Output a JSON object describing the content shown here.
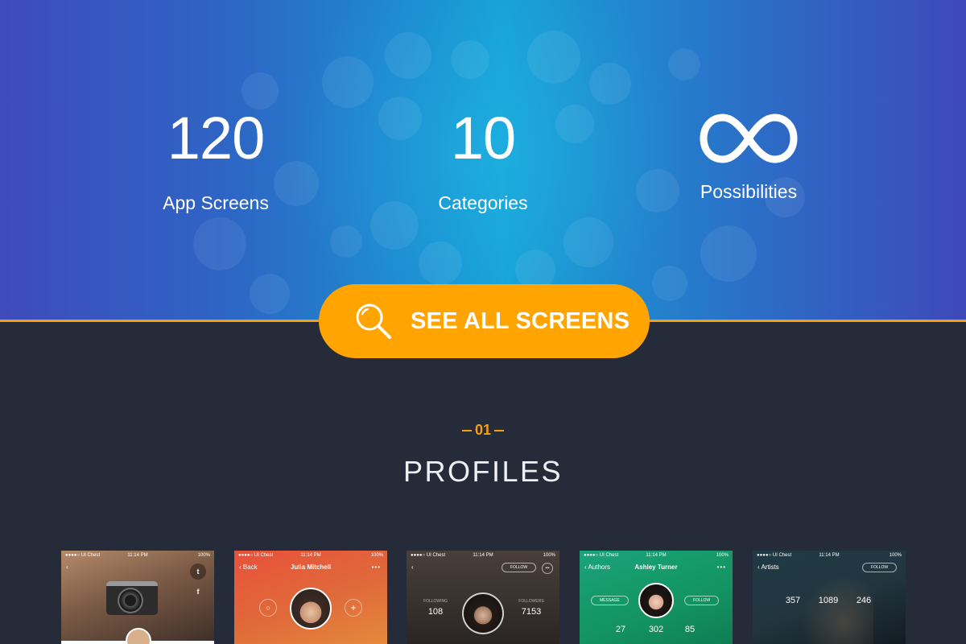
{
  "stats": [
    {
      "value": "120",
      "label": "App Screens"
    },
    {
      "value": "10",
      "label": "Categories"
    },
    {
      "value": "∞",
      "label": "Possibilities"
    }
  ],
  "cta": {
    "label": "SEE ALL SCREENS",
    "icon": "search-icon"
  },
  "section": {
    "number": "01",
    "title": "PROFILES"
  },
  "colors": {
    "accent": "#ffa400",
    "background": "#262b3a",
    "hero_start": "#3f4bbb",
    "hero_mid": "#17a0d6"
  },
  "phones": [
    {
      "carrier": "●●●●○ UI Chest",
      "time": "11:14 PM",
      "battery": "100%"
    },
    {
      "carrier": "●●●●○ UI Chest",
      "time": "11:14 PM",
      "battery": "100%",
      "back": "Back",
      "title": "Julia Mitchell",
      "more": "•••"
    },
    {
      "carrier": "●●●●○ UI Chest",
      "time": "11:14 PM",
      "battery": "100%",
      "follow": "FOLLOW",
      "more": "•••",
      "following_label": "FOLLOWING",
      "following": "108",
      "followers_label": "FOLLOWERS",
      "followers": "7153"
    },
    {
      "carrier": "●●●●○ UI Chest",
      "time": "11:14 PM",
      "battery": "100%",
      "back": "Authors",
      "title": "Ashley Turner",
      "more": "•••",
      "message": "MESSAGE",
      "follow": "FOLLOW",
      "stat1": "27",
      "stat2": "302",
      "stat3": "85"
    },
    {
      "carrier": "●●●●○ UI Chest",
      "time": "11:14 PM",
      "battery": "100%",
      "back": "Artists",
      "follow": "FOLLOW",
      "stat1": "357",
      "stat2": "1089",
      "stat3": "246"
    }
  ]
}
